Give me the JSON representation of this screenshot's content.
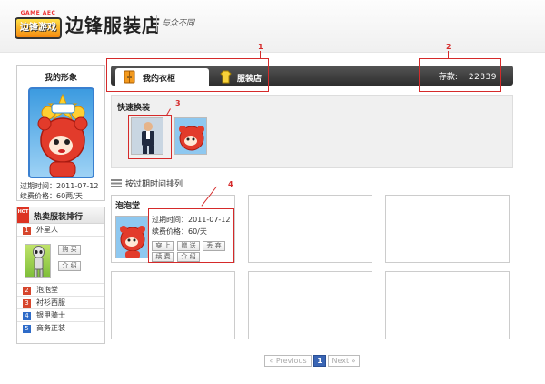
{
  "header": {
    "logo_caption": "GAME AEC",
    "logo_text": "边锋游戏",
    "site_title": "边锋服装店",
    "slogan": "与众不同"
  },
  "profile": {
    "title": "我的形象",
    "expire": "过期时间：2011-07-12",
    "fee": "续费价格：60两/天"
  },
  "ranking": {
    "hot_badge": "HOT",
    "title": "热卖服装排行",
    "items": [
      {
        "rank": "1",
        "name": "外星人",
        "color": "#d6452c"
      },
      {
        "rank": "2",
        "name": "泡泡堂",
        "color": "#d6452c"
      },
      {
        "rank": "3",
        "name": "衬衫西服",
        "color": "#d6452c"
      },
      {
        "rank": "4",
        "name": "银甲骑士",
        "color": "#2e6bc8"
      },
      {
        "rank": "5",
        "name": "商务正装",
        "color": "#2e6bc8"
      }
    ],
    "buy_label": "购 买",
    "intro_label": "介 绍"
  },
  "tabs": {
    "wardrobe": "我的衣柜",
    "shop": "服装店"
  },
  "deposit": {
    "label": "存款:",
    "value": "22839"
  },
  "quick": {
    "title": "快速换装"
  },
  "sort": {
    "label": "按过期时间排列"
  },
  "grid": {
    "item": {
      "name": "泡泡堂",
      "expire": "过期时间：2011-07-12",
      "fee": "续费价格：60/天",
      "actions": [
        "穿 上",
        "赠 送",
        "丢 弃",
        "续 费",
        "介 绍"
      ]
    }
  },
  "pagination": {
    "prev": "« Previous",
    "current": "1",
    "next": "Next »"
  },
  "annotations": [
    "1",
    "2",
    "3",
    "4"
  ],
  "colors": {
    "tab_bar": "#3a3a3a",
    "annotation": "#d52a2a",
    "pager_active": "#3a65b4"
  }
}
